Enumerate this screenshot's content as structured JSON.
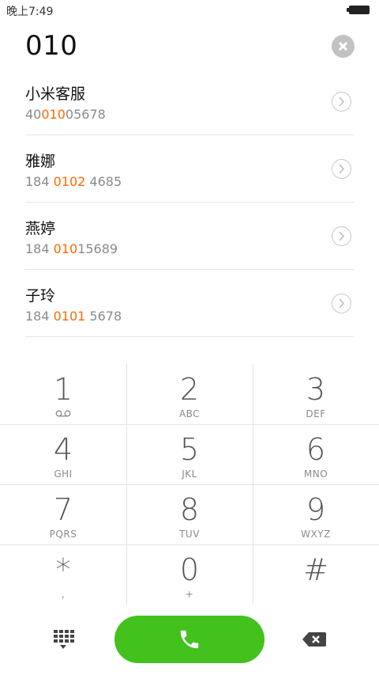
{
  "status_bar": {
    "time": "晚上7:49"
  },
  "dial_input": {
    "number": "010"
  },
  "results": [
    {
      "name": "小米客服",
      "pre": "40",
      "match": "010",
      "post": "05678"
    },
    {
      "name": "雅娜",
      "pre": "184 ",
      "match": "0102",
      "post": " 4685"
    },
    {
      "name": "燕婷",
      "pre": "184 ",
      "match": "010",
      "post": "15689"
    },
    {
      "name": "子玲",
      "pre": "184 ",
      "match": "0101",
      "post": " 5678"
    }
  ],
  "keypad": {
    "keys": [
      {
        "digit": "1",
        "letters": ""
      },
      {
        "digit": "2",
        "letters": "ABC"
      },
      {
        "digit": "3",
        "letters": "DEF"
      },
      {
        "digit": "4",
        "letters": "GHI"
      },
      {
        "digit": "5",
        "letters": "JKL"
      },
      {
        "digit": "6",
        "letters": "MNO"
      },
      {
        "digit": "7",
        "letters": "PQRS"
      },
      {
        "digit": "8",
        "letters": "TUV"
      },
      {
        "digit": "9",
        "letters": "WXYZ"
      },
      {
        "digit": "*",
        "letters": ","
      },
      {
        "digit": "0",
        "letters": "+"
      },
      {
        "digit": "#",
        "letters": ""
      }
    ],
    "voicemail_icon": "voicemail-icon"
  },
  "colors": {
    "accent": "#ff6a00",
    "call_button": "#43c11d"
  },
  "icons": {
    "clear": "clear-icon",
    "detail": "chevron-right-icon",
    "dialpad": "dialpad-icon",
    "call": "phone-icon",
    "backspace": "backspace-icon"
  }
}
